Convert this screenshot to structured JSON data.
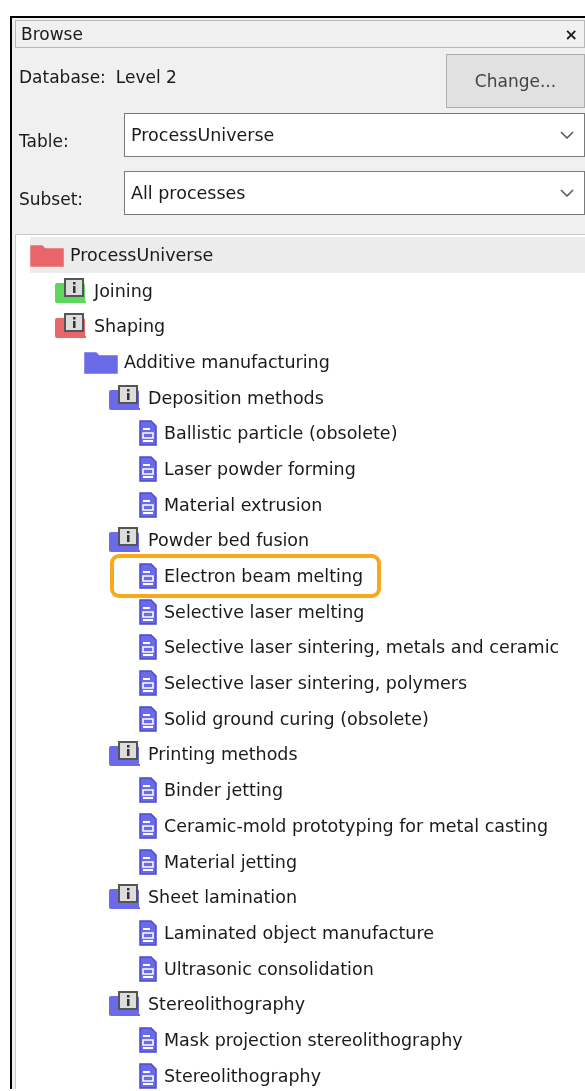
{
  "panel": {
    "title": "Browse",
    "close": "×"
  },
  "database": {
    "label": "Database:",
    "value": "Level 2",
    "button": "Change..."
  },
  "fields": [
    {
      "label": "Table:",
      "value": "ProcessUniverse"
    },
    {
      "label": "Subset:",
      "value": "All processes"
    }
  ],
  "tree": [
    {
      "label": "ProcessUniverse",
      "kind": "folder",
      "color": "#e8666a",
      "selected": true,
      "highlighted": false,
      "children": [
        {
          "label": "Joining",
          "kind": "record-folder",
          "color": "#5fd65f",
          "selected": false,
          "highlighted": false
        },
        {
          "label": "Shaping",
          "kind": "record-folder",
          "color": "#e8666a",
          "selected": false,
          "highlighted": false,
          "children": [
            {
              "label": "Additive manufacturing",
              "kind": "folder",
              "color": "#6b6bea",
              "selected": false,
              "highlighted": false,
              "children": [
                {
                  "label": "Deposition methods",
                  "kind": "record-folder",
                  "color": "#6b6bea",
                  "selected": false,
                  "highlighted": false,
                  "children": [
                    {
                      "label": "Ballistic particle (obsolete)",
                      "kind": "record",
                      "selected": false,
                      "highlighted": false
                    },
                    {
                      "label": "Laser powder forming",
                      "kind": "record",
                      "selected": false,
                      "highlighted": false
                    },
                    {
                      "label": "Material extrusion",
                      "kind": "record",
                      "selected": false,
                      "highlighted": false
                    }
                  ]
                },
                {
                  "label": "Powder bed fusion",
                  "kind": "record-folder",
                  "color": "#6b6bea",
                  "selected": false,
                  "highlighted": false,
                  "children": [
                    {
                      "label": "Electron beam melting",
                      "kind": "record",
                      "selected": false,
                      "highlighted": true
                    },
                    {
                      "label": "Selective laser melting",
                      "kind": "record",
                      "selected": false,
                      "highlighted": false
                    },
                    {
                      "label": "Selective laser sintering, metals and ceramic",
                      "kind": "record",
                      "selected": false,
                      "highlighted": false
                    },
                    {
                      "label": "Selective laser sintering, polymers",
                      "kind": "record",
                      "selected": false,
                      "highlighted": false
                    },
                    {
                      "label": "Solid ground curing (obsolete)",
                      "kind": "record",
                      "selected": false,
                      "highlighted": false
                    }
                  ]
                },
                {
                  "label": "Printing methods",
                  "kind": "record-folder",
                  "color": "#6b6bea",
                  "selected": false,
                  "highlighted": false,
                  "children": [
                    {
                      "label": "Binder jetting",
                      "kind": "record",
                      "selected": false,
                      "highlighted": false
                    },
                    {
                      "label": "Ceramic-mold prototyping for metal casting",
                      "kind": "record",
                      "selected": false,
                      "highlighted": false
                    },
                    {
                      "label": "Material jetting",
                      "kind": "record",
                      "selected": false,
                      "highlighted": false
                    }
                  ]
                },
                {
                  "label": "Sheet lamination",
                  "kind": "record-folder",
                  "color": "#6b6bea",
                  "selected": false,
                  "highlighted": false,
                  "children": [
                    {
                      "label": "Laminated object manufacture",
                      "kind": "record",
                      "selected": false,
                      "highlighted": false
                    },
                    {
                      "label": "Ultrasonic consolidation",
                      "kind": "record",
                      "selected": false,
                      "highlighted": false
                    }
                  ]
                },
                {
                  "label": "Stereolithography",
                  "kind": "record-folder",
                  "color": "#6b6bea",
                  "selected": false,
                  "highlighted": false,
                  "children": [
                    {
                      "label": "Mask projection stereolithography",
                      "kind": "record",
                      "selected": false,
                      "highlighted": false
                    },
                    {
                      "label": "Stereolithography",
                      "kind": "record",
                      "selected": false,
                      "highlighted": false
                    }
                  ]
                }
              ]
            }
          ]
        }
      ]
    }
  ]
}
